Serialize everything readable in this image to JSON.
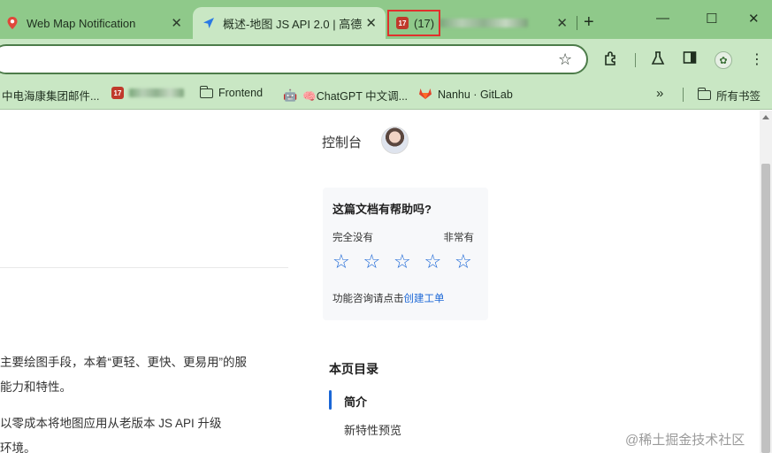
{
  "tabs": [
    {
      "label": "Web Map Notification",
      "icon": "map-pin-icon",
      "active": false
    },
    {
      "label": "概述-地图 JS API 2.0 | 高德",
      "icon": "amap-arrow-icon",
      "active": true
    },
    {
      "label": "(17)",
      "icon": "badge-17-icon",
      "active": false
    }
  ],
  "window": {
    "new_tab": "+",
    "minimize": "—",
    "maximize": "☐",
    "close": "✕",
    "tab_close": "✕"
  },
  "bookmarks": [
    {
      "label": "中电海康集团邮件...",
      "icon": "none"
    },
    {
      "label": "",
      "icon": "badge-17-icon",
      "badge": "17"
    },
    {
      "label": "Frontend",
      "icon": "folder-icon"
    },
    {
      "label": "🧠ChatGPT 中文调...",
      "icon": "bot-icon"
    },
    {
      "label": "Nanhu · GitLab",
      "icon": "gitlab-fox-icon"
    },
    {
      "label": "所有书签",
      "icon": "folder-icon"
    }
  ],
  "bookmarks_more": "»",
  "header": {
    "console": "控制台"
  },
  "paragraphs": [
    "主要绘图手段，本着“更轻、更快、更易用”的服",
    "能力和特性。",
    "以零成本将地图应用从老版本 JS API 升级",
    "环境。"
  ],
  "feedback": {
    "title": "这篇文档有帮助吗?",
    "low": "完全没有",
    "high": "非常有",
    "stars": [
      "☆",
      "☆",
      "☆",
      "☆",
      "☆"
    ],
    "consult_prefix": "功能咨询请点击",
    "consult_link": "创建工单"
  },
  "toc": {
    "title": "本页目录",
    "items": [
      "简介",
      "新特性预览"
    ]
  },
  "watermark": "@稀土掘金技术社区",
  "colors": {
    "accent": "#1a66d6",
    "tabstrip": "#8fc98a",
    "toolbar": "#c9e7c4",
    "highlight": "#e0302c"
  }
}
